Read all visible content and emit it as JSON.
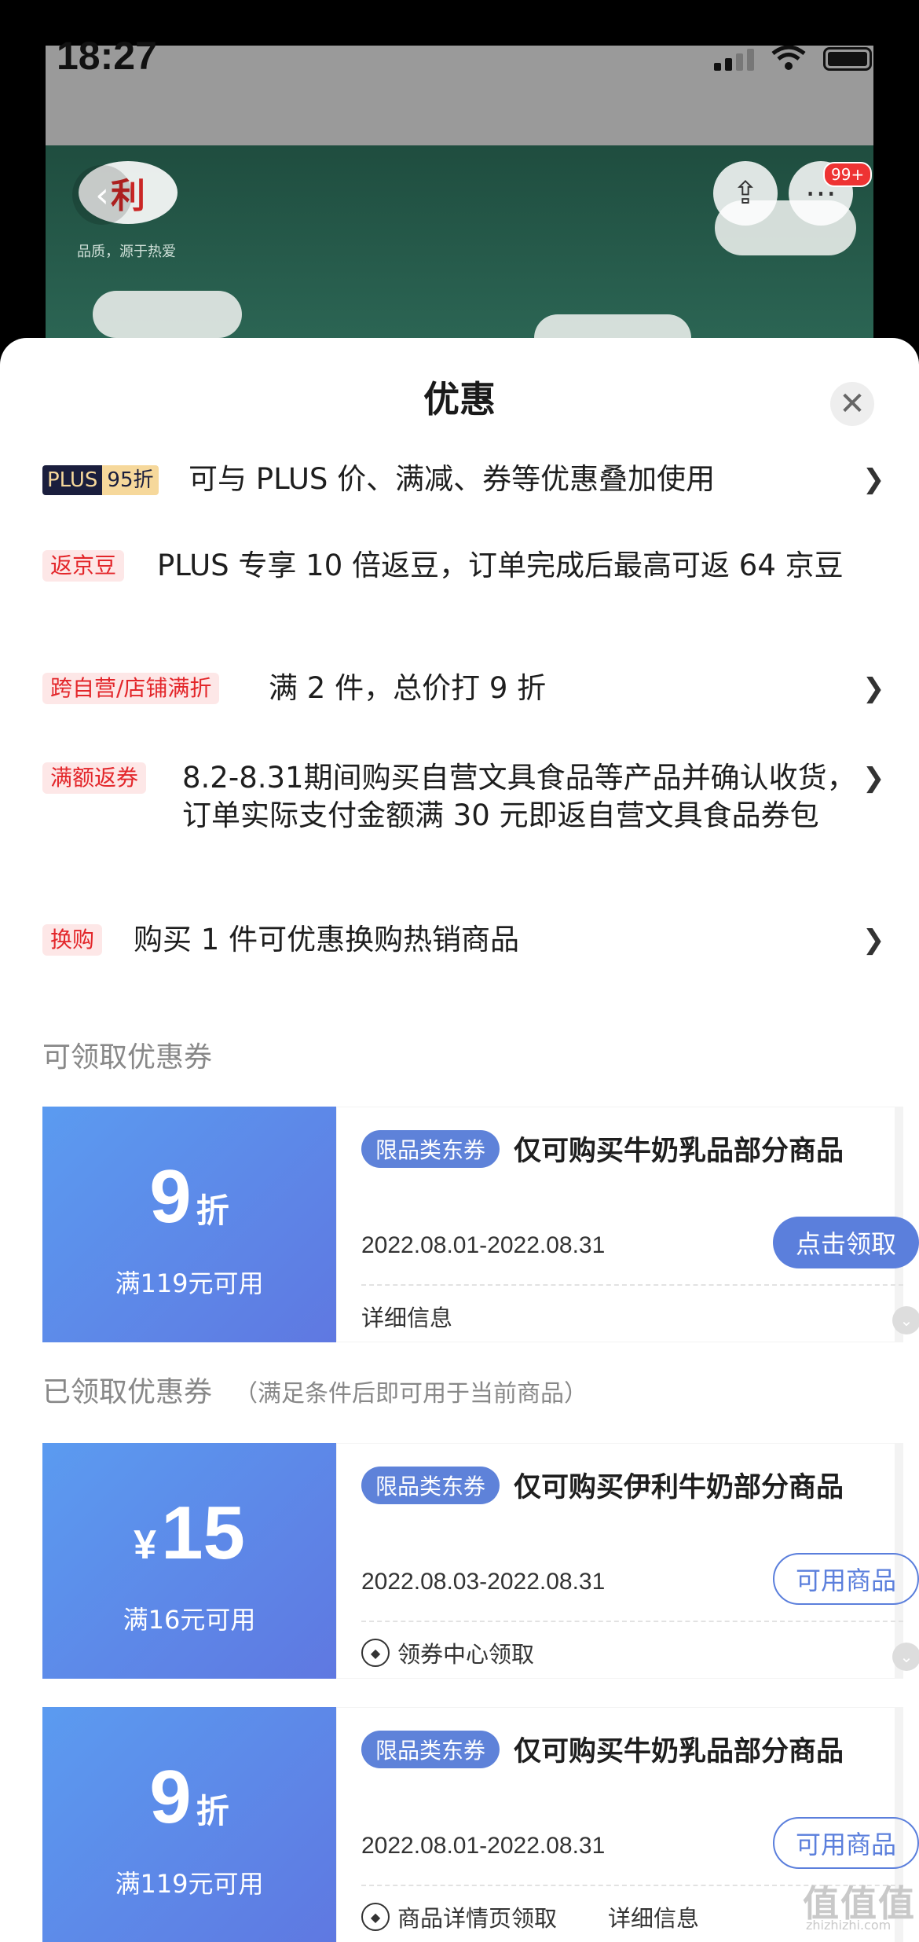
{
  "status": {
    "time": "18:27"
  },
  "background": {
    "brand": "利",
    "slogan": "品质，源于热爱",
    "badge": "99+"
  },
  "sheet": {
    "title": "优惠",
    "promos": [
      {
        "tag_left": "PLUS",
        "tag_right": "95折",
        "text": "可与 PLUS 价、满减、券等优惠叠加使用"
      },
      {
        "tag": "返京豆",
        "text": "PLUS 专享 10 倍返豆，订单完成后最高可返 64 京豆"
      },
      {
        "tag": "跨自营/店铺满折",
        "text": "满 2 件，总价打 9 折"
      },
      {
        "tag": "满额返券",
        "text": "8.2-8.31期间购买自营文具食品等产品并确认收货，订单实际支付金额满 30 元即返自营文具食品券包"
      },
      {
        "tag": "换购",
        "text": "购买 1 件可优惠换购热销商品"
      }
    ],
    "available_heading": "可领取优惠券",
    "claimed_heading": "已领取优惠券",
    "claimed_note": "（满足条件后即可用于当前商品）",
    "coupons": [
      {
        "value": "9",
        "unit": "折",
        "condition": "满119元可用",
        "tag": "限品类东券",
        "title": "仅可购买牛奶乳品部分商品",
        "date": "2022.08.01-2022.08.31",
        "button": "点击领取",
        "footer": "详细信息"
      },
      {
        "currency": "¥",
        "value": "15",
        "condition": "满16元可用",
        "tag": "限品类东券",
        "title": "仅可购买伊利牛奶部分商品",
        "date": "2022.08.03-2022.08.31",
        "button": "可用商品",
        "footer": "领券中心领取"
      },
      {
        "value": "9",
        "unit": "折",
        "condition": "满119元可用",
        "tag": "限品类东券",
        "title": "仅可购买牛奶乳品部分商品",
        "date": "2022.08.01-2022.08.31",
        "button": "可用商品",
        "footer": "商品详情页领取",
        "footer2": "详细信息"
      }
    ]
  },
  "watermark": {
    "text": "值值值",
    "url": "zhizhizhi.com"
  }
}
